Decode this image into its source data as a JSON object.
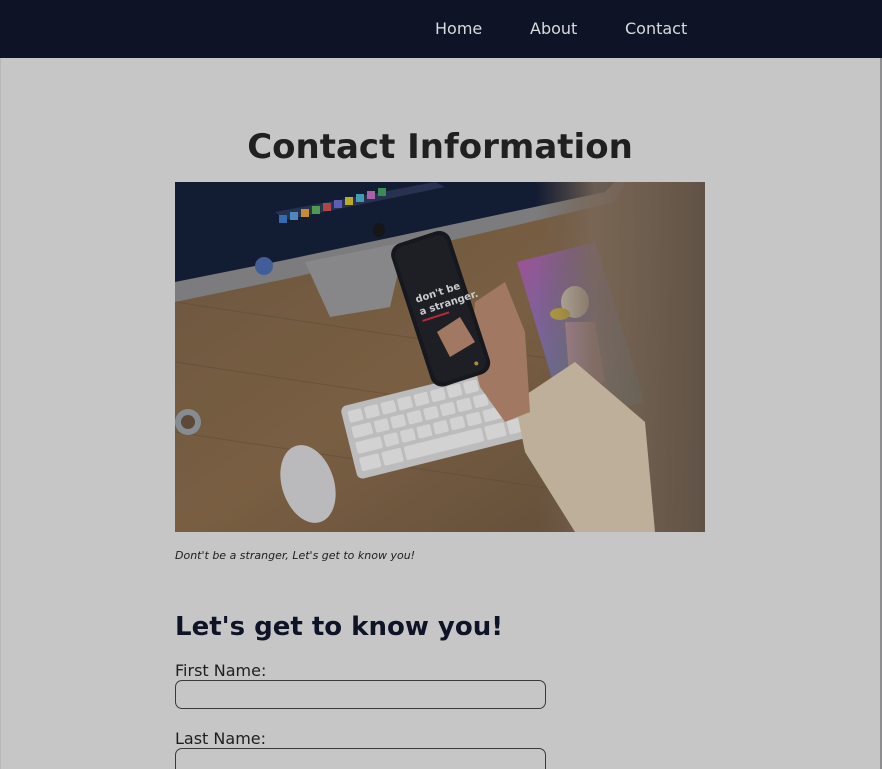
{
  "nav": {
    "links": [
      {
        "label": "Home"
      },
      {
        "label": "About"
      },
      {
        "label": "Contact"
      }
    ]
  },
  "main": {
    "title": "Contact Information",
    "image": {
      "screen_text_line1": "don't be",
      "screen_text_line2": "a stranger."
    },
    "caption": "Dont't be a stranger, Let's get to know you!"
  },
  "form": {
    "heading": "Let's get to know you!",
    "first_name": {
      "label": "First Name:",
      "value": ""
    },
    "last_name": {
      "label": "Last Name:",
      "value": ""
    }
  },
  "colors": {
    "nav_background": "#0e1426",
    "page_background": "#c6c6c7",
    "heading_color": "#0e1426"
  }
}
